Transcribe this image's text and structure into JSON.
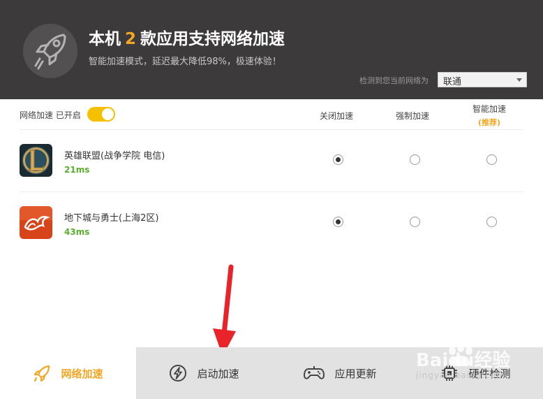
{
  "header": {
    "title_prefix": "本机",
    "title_count": "2",
    "title_suffix": "款应用支持网络加速",
    "subtitle": "智能加速模式，延迟最大降低98%，极速体验！",
    "network_label": "检测到您当前网络为",
    "network_value": "联通",
    "accent_color": "#f5a623",
    "bg_color": "#3c3a3b"
  },
  "toggle": {
    "label": "网络加速 已开启",
    "on": true,
    "color": "#f5c000"
  },
  "columns": [
    {
      "label": "关闭加速"
    },
    {
      "label": "强制加速"
    },
    {
      "label": "智能加速",
      "sub": "(推荐)"
    }
  ],
  "games": [
    {
      "name": "英雄联盟(战争学院 电信)",
      "ping": "21ms",
      "icon": "league-of-legends-icon",
      "selected_mode": 0
    },
    {
      "name": "地下城与勇士(上海2区)",
      "ping": "43ms",
      "icon": "dnf-icon",
      "selected_mode": 0
    }
  ],
  "bottom_tabs": [
    {
      "label": "网络加速",
      "icon": "rocket-icon",
      "active": true
    },
    {
      "label": "启动加速",
      "icon": "lightning-icon",
      "active": false
    },
    {
      "label": "应用更新",
      "icon": "gamepad-icon",
      "active": false
    },
    {
      "label": "硬件检测",
      "icon": "chip-icon",
      "active": false
    }
  ],
  "watermark": {
    "brand": "Baidu经验",
    "domain": "jingyan.baidu.com"
  },
  "colors": {
    "ping_green": "#5aae2e",
    "annotation_red": "#e8232a"
  }
}
